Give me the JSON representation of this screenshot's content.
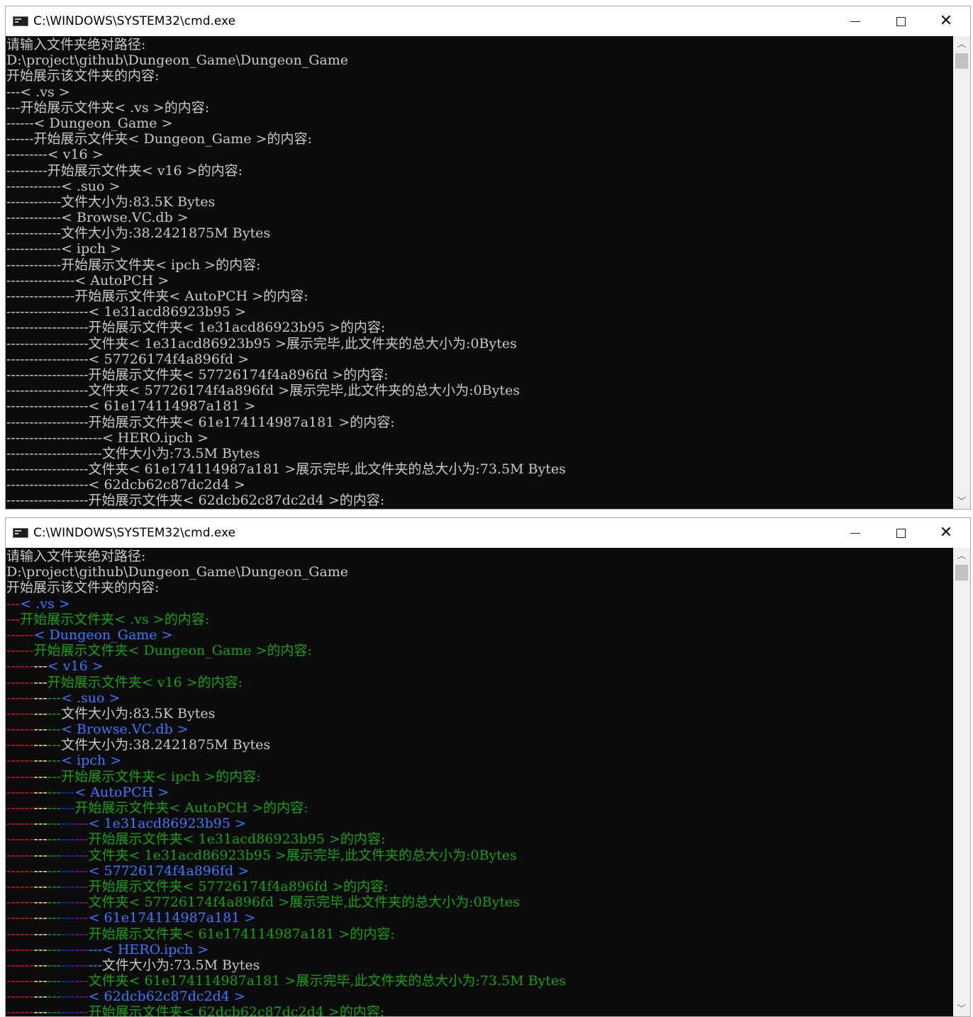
{
  "windows": [
    {
      "title": "C:\\WINDOWS\\SYSTEM32\\cmd.exe",
      "colored": false,
      "lines": [
        "请输入文件夹绝对路径:",
        "D:\\project\\github\\Dungeon_Game\\Dungeon_Game",
        "开始展示该文件夹的内容:",
        "---< .vs >",
        "---开始展示文件夹< .vs >的内容:",
        "------< Dungeon_Game >",
        "------开始展示文件夹< Dungeon_Game >的内容:",
        "---------< v16 >",
        "---------开始展示文件夹< v16 >的内容:",
        "------------< .suo >",
        "------------文件大小为:83.5K Bytes",
        "------------< Browse.VC.db >",
        "------------文件大小为:38.2421875M Bytes",
        "------------< ipch >",
        "------------开始展示文件夹< ipch >的内容:",
        "---------------< AutoPCH >",
        "---------------开始展示文件夹< AutoPCH >的内容:",
        "------------------< 1e31acd86923b95 >",
        "------------------开始展示文件夹< 1e31acd86923b95 >的内容:",
        "------------------文件夹< 1e31acd86923b95 >展示完毕,此文件夹的总大小为:0Bytes",
        "------------------< 57726174f4a896fd >",
        "------------------开始展示文件夹< 57726174f4a896fd >的内容:",
        "------------------文件夹< 57726174f4a896fd >展示完毕,此文件夹的总大小为:0Bytes",
        "------------------< 61e174114987a181 >",
        "------------------开始展示文件夹< 61e174114987a181 >的内容:",
        "---------------------< HERO.ipch >",
        "---------------------文件大小为:73.5M Bytes",
        "------------------文件夹< 61e174114987a181 >展示完毕,此文件夹的总大小为:73.5M Bytes",
        "------------------< 62dcb62c87dc2d4 >",
        "------------------开始展示文件夹< 62dcb62c87dc2d4 >的内容:"
      ]
    },
    {
      "title": "C:\\WINDOWS\\SYSTEM32\\cmd.exe",
      "colored": true,
      "lines": [
        "请输入文件夹绝对路径:",
        "D:\\project\\github\\Dungeon_Game\\Dungeon_Game",
        "开始展示该文件夹的内容:",
        "---< .vs >",
        "---开始展示文件夹< .vs >的内容:",
        "------< Dungeon_Game >",
        "------开始展示文件夹< Dungeon_Game >的内容:",
        "---------< v16 >",
        "---------开始展示文件夹< v16 >的内容:",
        "------------< .suo >",
        "------------文件大小为:83.5K Bytes",
        "------------< Browse.VC.db >",
        "------------文件大小为:38.2421875M Bytes",
        "------------< ipch >",
        "------------开始展示文件夹< ipch >的内容:",
        "---------------< AutoPCH >",
        "---------------开始展示文件夹< AutoPCH >的内容:",
        "------------------< 1e31acd86923b95 >",
        "------------------开始展示文件夹< 1e31acd86923b95 >的内容:",
        "------------------文件夹< 1e31acd86923b95 >展示完毕,此文件夹的总大小为:0Bytes",
        "------------------< 57726174f4a896fd >",
        "------------------开始展示文件夹< 57726174f4a896fd >的内容:",
        "------------------文件夹< 57726174f4a896fd >展示完毕,此文件夹的总大小为:0Bytes",
        "------------------< 61e174114987a181 >",
        "------------------开始展示文件夹< 61e174114987a181 >的内容:",
        "---------------------< HERO.ipch >",
        "---------------------文件大小为:73.5M Bytes",
        "------------------文件夹< 61e174114987a181 >展示完毕,此文件夹的总大小为:73.5M Bytes",
        "------------------< 62dcb62c87dc2d4 >",
        "------------------开始展示文件夹< 62dcb62c87dc2d4 >的内容:"
      ]
    }
  ],
  "colors": {
    "console_bg": "#0c0c0c",
    "default_text": "#c9c9c9",
    "folder_name_text": "#3b78ff",
    "folder_start_text": "#13a10e",
    "folder_done_text": "#13a10e",
    "file_size_text": "#c9c9c9",
    "depth_dash_colors": [
      "#e81123",
      "#e81123",
      "#f9f1a5",
      "#13a10e",
      "#0037da",
      "#881798",
      "#3a96dd"
    ]
  },
  "icons": {
    "app": "cmd-icon",
    "minimize": "minimize-icon",
    "maximize": "maximize-icon",
    "close": "close-icon",
    "scroll_up": "scroll-up-icon",
    "scroll_down": "scroll-down-icon"
  }
}
